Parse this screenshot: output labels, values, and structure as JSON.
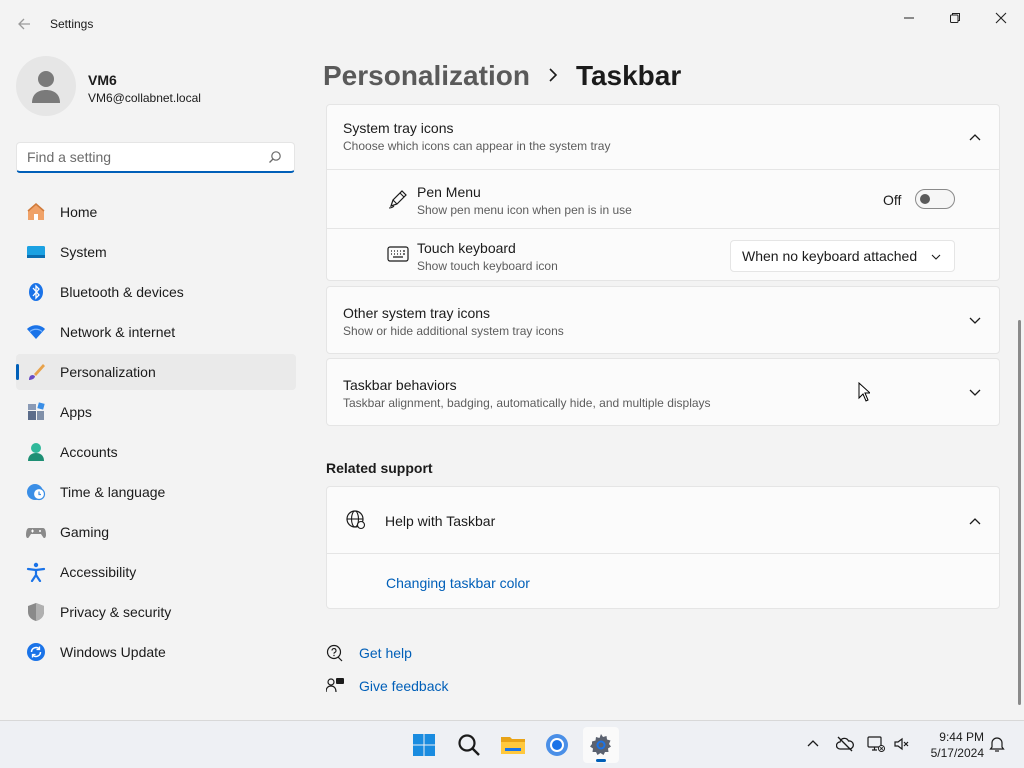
{
  "window": {
    "title": "Settings"
  },
  "user": {
    "name": "VM6",
    "email": "VM6@collabnet.local"
  },
  "search": {
    "placeholder": "Find a setting"
  },
  "sidebar": {
    "items": [
      {
        "label": "Home",
        "icon": "home-icon"
      },
      {
        "label": "System",
        "icon": "system-icon"
      },
      {
        "label": "Bluetooth & devices",
        "icon": "bluetooth-icon"
      },
      {
        "label": "Network & internet",
        "icon": "wifi-icon"
      },
      {
        "label": "Personalization",
        "icon": "brush-icon",
        "active": true
      },
      {
        "label": "Apps",
        "icon": "apps-icon"
      },
      {
        "label": "Accounts",
        "icon": "accounts-icon"
      },
      {
        "label": "Time & language",
        "icon": "clock-globe-icon"
      },
      {
        "label": "Gaming",
        "icon": "gamepad-icon"
      },
      {
        "label": "Accessibility",
        "icon": "accessibility-icon"
      },
      {
        "label": "Privacy & security",
        "icon": "shield-icon"
      },
      {
        "label": "Windows Update",
        "icon": "update-icon"
      }
    ]
  },
  "breadcrumb": {
    "parent": "Personalization",
    "separator": ">",
    "current": "Taskbar"
  },
  "system_tray": {
    "title": "System tray icons",
    "subtitle": "Choose which icons can appear in the system tray",
    "pen_menu": {
      "title": "Pen Menu",
      "subtitle": "Show pen menu icon when pen is in use",
      "state_label": "Off",
      "on": false
    },
    "touch_keyboard": {
      "title": "Touch keyboard",
      "subtitle": "Show touch keyboard icon",
      "value": "When no keyboard attached"
    }
  },
  "other_tray": {
    "title": "Other system tray icons",
    "subtitle": "Show or hide additional system tray icons"
  },
  "behaviors": {
    "title": "Taskbar behaviors",
    "subtitle": "Taskbar alignment, badging, automatically hide, and multiple displays"
  },
  "related": {
    "heading": "Related support",
    "help_title": "Help with Taskbar",
    "link": "Changing taskbar color"
  },
  "footer_links": {
    "get_help": "Get help",
    "feedback": "Give feedback"
  },
  "taskbar": {
    "apps": [
      "start-icon",
      "search-icon",
      "file-explorer-icon",
      "chrome-icon",
      "settings-icon"
    ],
    "time": "9:44 PM",
    "date": "5/17/2024"
  },
  "colors": {
    "accent": "#005fb8",
    "background": "#f3f3f3",
    "card": "#fbfbfb"
  }
}
